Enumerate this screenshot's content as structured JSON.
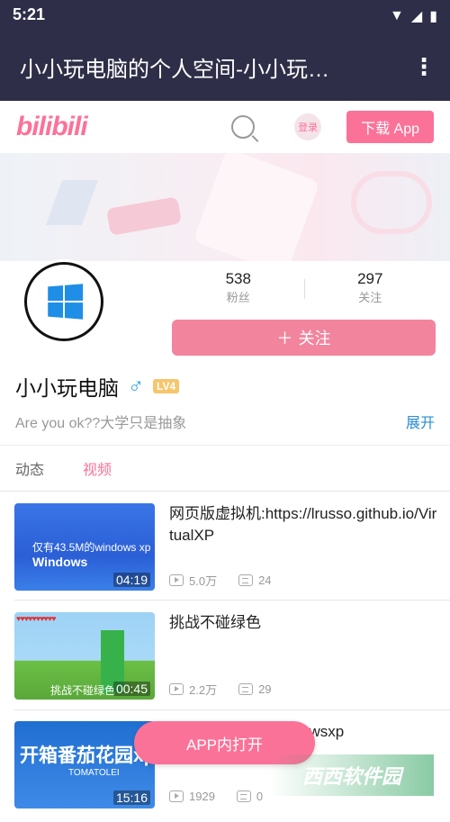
{
  "status_bar": {
    "time": "5:21"
  },
  "app_bar": {
    "title": "小小玩电脑的个人空间-小小玩…"
  },
  "site_header": {
    "logo": "bilibili",
    "login": "登录",
    "download": "下载 App"
  },
  "profile": {
    "fans_count": "538",
    "fans_label": "粉丝",
    "following_count": "297",
    "following_label": "关注",
    "follow_button": "关注",
    "name": "小小玩电脑",
    "level": "LV4",
    "bio": "Are you ok??大学只是抽象",
    "expand": "展开"
  },
  "tabs": [
    {
      "label": "动态",
      "active": false
    },
    {
      "label": "视频",
      "active": true
    }
  ],
  "videos": [
    {
      "title": "网页版虚拟机:https://lrusso.github.io/VirtualXP",
      "duration": "04:19",
      "views": "5.0万",
      "danmaku": "24",
      "thumb_text": "仅有43.5M的windows xp",
      "thumb_logo": "Windows"
    },
    {
      "title": "挑战不碰绿色",
      "duration": "00:45",
      "views": "2.2万",
      "danmaku": "29",
      "thumb_text": "挑战不碰绿色",
      "thumb_hud": "♥♥♥♥♥♥♥♥♥♥"
    },
    {
      "title": "owsxp",
      "duration": "15:16",
      "views": "1929",
      "danmaku": "0",
      "thumb_text": "开箱番茄花园xp",
      "thumb_sub": "TOMATOLEI"
    }
  ],
  "open_app_button": "APP内打开",
  "watermark": "西西软件园",
  "colors": {
    "brand_pink": "#fb7299",
    "appbar": "#2e2e48",
    "link_blue": "#2a8cd6"
  }
}
